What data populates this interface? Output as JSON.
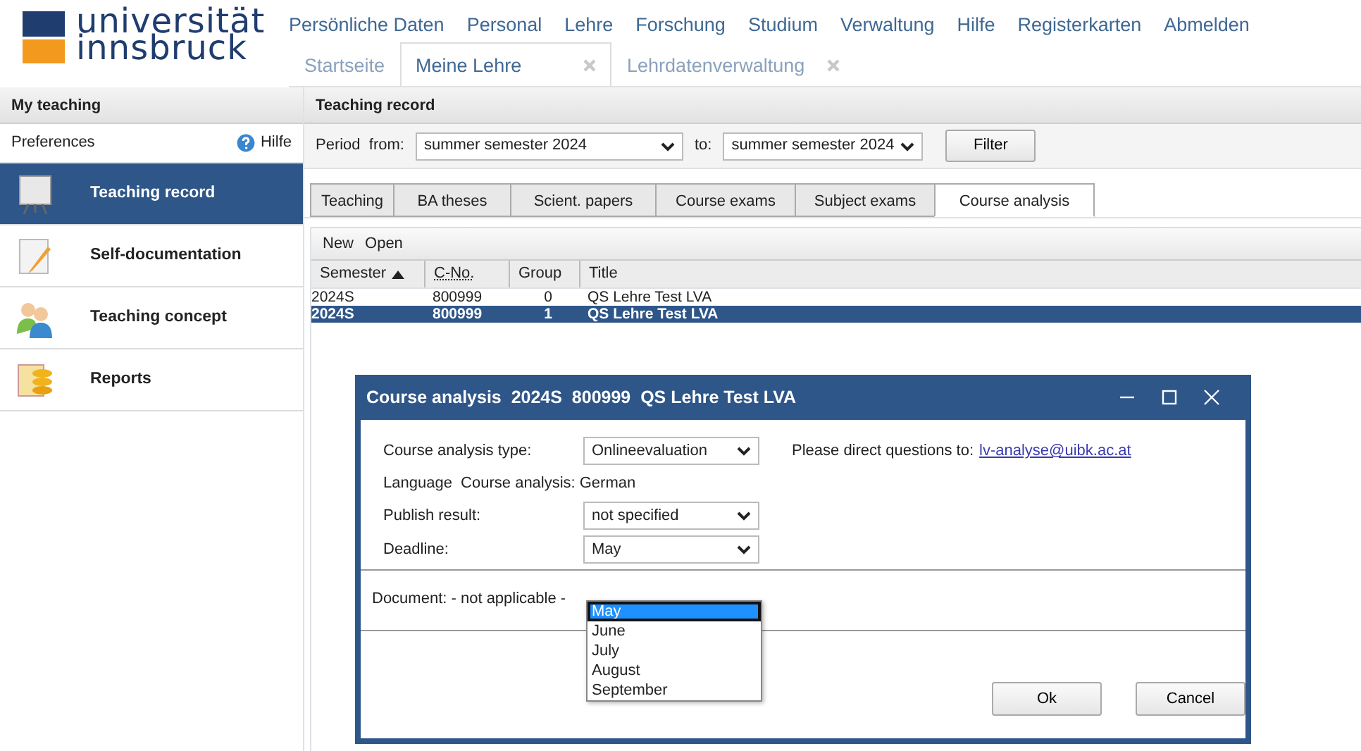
{
  "logo": {
    "line_1": "universität",
    "line_2": "innsbruck"
  },
  "top_menu": [
    "Persönliche Daten",
    "Personal",
    "Lehre",
    "Forschung",
    "Studium",
    "Verwaltung",
    "Hilfe",
    "Registerkarten",
    "Abmelden"
  ],
  "page_tabs": [
    {
      "label": "Startseite",
      "selected": false,
      "closable": false
    },
    {
      "label": "Meine Lehre",
      "selected": true,
      "closable": true
    },
    {
      "label": "Lehrdatenverwaltung",
      "selected": false,
      "closable": true
    }
  ],
  "sidebar": {
    "title": "My teaching",
    "preferences": "Preferences",
    "help": "Hilfe",
    "items": [
      {
        "label": "Teaching record",
        "selected": true,
        "kind": "board"
      },
      {
        "label": "Self-documentation",
        "selected": false,
        "kind": "note"
      },
      {
        "label": "Teaching concept",
        "selected": false,
        "kind": "people"
      },
      {
        "label": "Reports",
        "selected": false,
        "kind": "report"
      }
    ]
  },
  "main": {
    "title": "Teaching record",
    "period_from_label": "Period  from:",
    "period_from": "summer semester 2024",
    "period_to_label": "to:",
    "period_to": "summer semester 2024",
    "filter_button": "Filter",
    "tabs": [
      {
        "label": "Teaching",
        "selected": false
      },
      {
        "label": "BA theses",
        "selected": false
      },
      {
        "label": "Scient. papers",
        "selected": false
      },
      {
        "label": "Course exams",
        "selected": false
      },
      {
        "label": "Subject exams",
        "selected": false
      },
      {
        "label": "Course analysis",
        "selected": true
      }
    ],
    "toolbar": [
      "New",
      "Open"
    ],
    "table": {
      "columns": [
        {
          "label": "Semester",
          "sorted": true
        },
        {
          "label": "C-No.",
          "sorted": false
        },
        {
          "label": "Group",
          "sorted": false
        },
        {
          "label": "Title",
          "sorted": false
        }
      ],
      "rows": [
        {
          "cells": [
            "2024S",
            "800999",
            "0",
            "QS Lehre Test LVA"
          ],
          "selected": false
        },
        {
          "cells": [
            "2024S",
            "800999",
            "1",
            "QS Lehre Test LVA"
          ],
          "selected": true
        }
      ]
    }
  },
  "dialog": {
    "title": "Course analysis  2024S  800999  QS Lehre Test LVA",
    "fields": [
      {
        "label": "Course analysis type:",
        "kind": "select",
        "value": "Onlineevaluation"
      },
      {
        "label": "Language  Course analysis:",
        "kind": "text",
        "value": "German"
      },
      {
        "label": "Publish result:",
        "kind": "select",
        "value": "not specified"
      },
      {
        "label": "Deadline:",
        "kind": "select",
        "value": "May"
      }
    ],
    "contact_text": "Please direct questions to:",
    "contact_email": "lv-analyse@uibk.ac.at",
    "document": "Document: - not applicable -",
    "dropdown_options": [
      {
        "label": "May",
        "selected": true
      },
      {
        "label": "June",
        "selected": false
      },
      {
        "label": "July",
        "selected": false
      },
      {
        "label": "August",
        "selected": false
      },
      {
        "label": "September",
        "selected": false
      }
    ],
    "buttons": [
      "Ok",
      "Cancel"
    ]
  }
}
